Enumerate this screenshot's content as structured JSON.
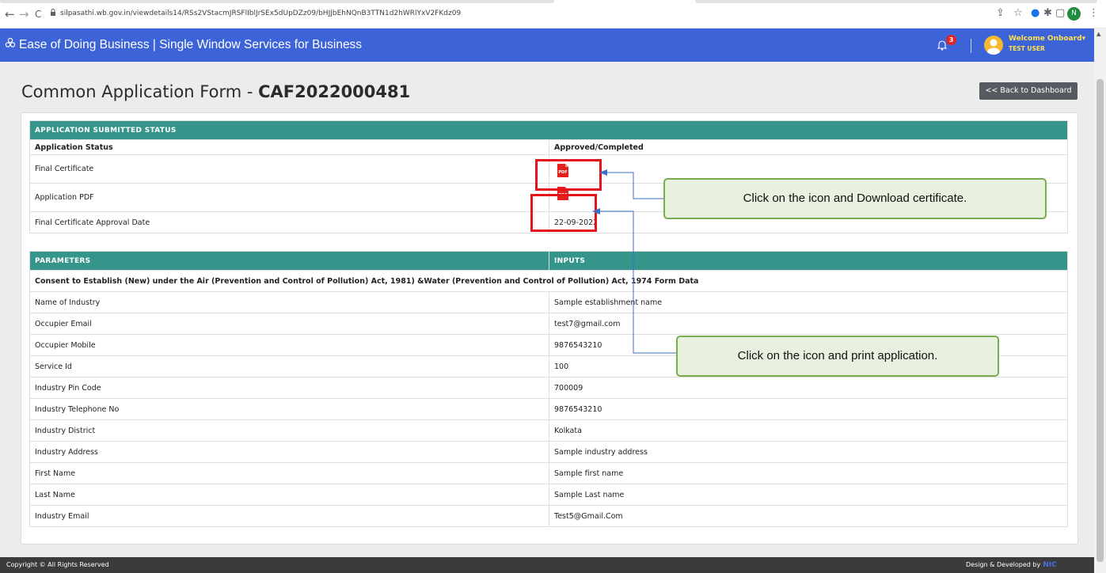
{
  "browser": {
    "url": "silpasathi.wb.gov.in/viewdetails14/RSs2VStacmJRSFlIblJrSEx5dUpDZz09/bHJJbEhNQnB3TTN1d2hWRlYxV2FKdz09",
    "back_glyph": "←",
    "forward_glyph": "→",
    "reload_glyph": "C",
    "profile_initial": "N"
  },
  "header": {
    "brand": "Ease of Doing Business | Single Window Services for Business",
    "notification_count": "3",
    "welcome": "Welcome Onboard▾",
    "user": "TEST USER",
    "bg_color": "#3c63d8"
  },
  "page": {
    "title_prefix": "Common Application Form - ",
    "caf_number": "CAF2022000481",
    "back_button": "<< Back to Dashboard"
  },
  "status_table": {
    "header": "APPLICATION SUBMITTED STATUS",
    "rows": [
      {
        "label": "Application Status",
        "value": "Approved/Completed"
      },
      {
        "label": "Final Certificate",
        "icon": "pdf"
      },
      {
        "label": "Application PDF",
        "icon": "pdf"
      },
      {
        "label": "Final Certificate Approval Date",
        "value": "22-09-2022"
      }
    ],
    "pdf_label": "PDF",
    "accent": "#36958b"
  },
  "params_table": {
    "col1": "PARAMETERS",
    "col2": "INPUTS",
    "section": "Consent to Establish (New) under the Air (Prevention and Control of Pollution) Act, 1981) &Water (Prevention and Control of Pollution) Act, 1974 Form Data",
    "rows": [
      {
        "label": "Name of Industry",
        "value": "Sample establishment name"
      },
      {
        "label": "Occupier Email",
        "value": "test7@gmail.com"
      },
      {
        "label": "Occupier Mobile",
        "value": "9876543210"
      },
      {
        "label": "Service Id",
        "value": "100"
      },
      {
        "label": "Industry Pin Code",
        "value": "700009"
      },
      {
        "label": "Industry Telephone No",
        "value": "9876543210"
      },
      {
        "label": "Industry District",
        "value": "Kolkata"
      },
      {
        "label": "Industry Address",
        "value": "Sample industry address"
      },
      {
        "label": "First Name",
        "value": "Sample first name"
      },
      {
        "label": "Last Name",
        "value": "Sample Last name"
      },
      {
        "label": "Industry Email",
        "value": "Test5@Gmail.Com"
      }
    ]
  },
  "callouts": {
    "download": "Click on the icon and Download certificate.",
    "print": "Click on the icon and print application."
  },
  "footer": {
    "copyright": "Copyright © All Rights Reserved",
    "credit": "Design & Developed by",
    "logo": "NIC"
  }
}
